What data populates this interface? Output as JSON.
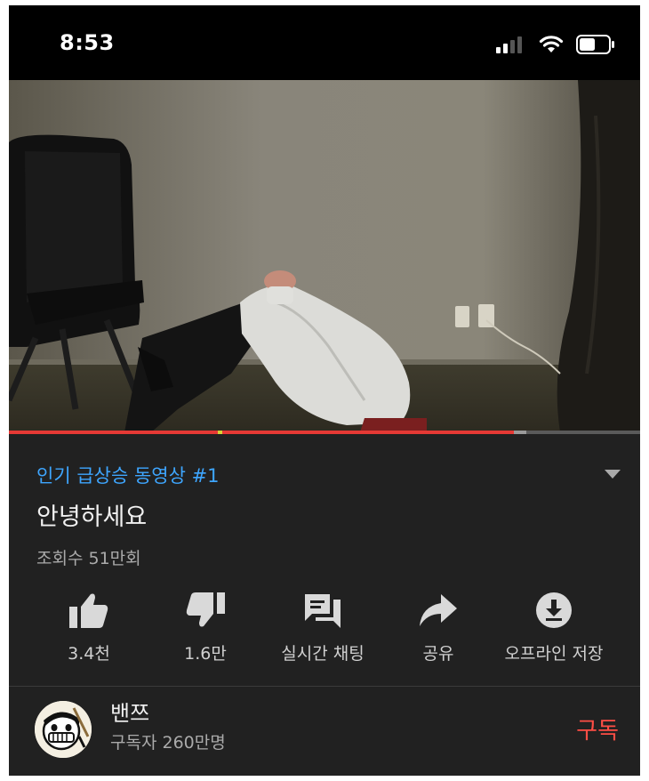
{
  "status_bar": {
    "time": "8:53"
  },
  "video": {
    "progress_played": 0.8,
    "progress_buffered": 0.82
  },
  "info": {
    "trending": "인기 급상승 동영상 #1",
    "title": "안녕하세요",
    "views": "조회수 51만회"
  },
  "actions": [
    {
      "label": "3.4천",
      "icon": "thumbs-up-icon"
    },
    {
      "label": "1.6만",
      "icon": "thumbs-down-icon"
    },
    {
      "label": "실시간 채팅",
      "icon": "chat-icon"
    },
    {
      "label": "공유",
      "icon": "share-icon"
    },
    {
      "label": "오프라인 저장",
      "icon": "download-icon"
    }
  ],
  "channel": {
    "name": "밴쯔",
    "subscribers": "구독자 260만명",
    "subscribe_label": "구독"
  },
  "colors": {
    "accent_link": "#3ea6ff",
    "subscribe": "#ff4e45",
    "progress": "#e53935"
  }
}
